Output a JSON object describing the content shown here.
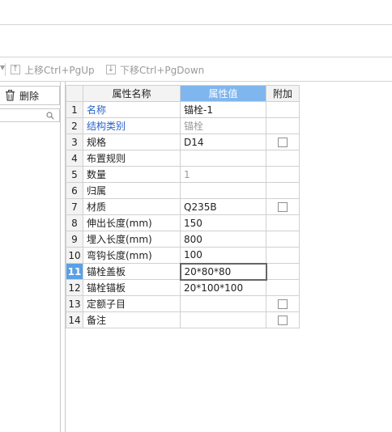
{
  "toolbar": {
    "move_up_label": "上移Ctrl+PgUp",
    "move_down_label": "下移Ctrl+PgDown"
  },
  "left_panel": {
    "delete_label": "删除",
    "search_placeholder": ""
  },
  "table": {
    "headers": {
      "name": "属性名称",
      "value": "属性值",
      "extra": "附加"
    },
    "rows": [
      {
        "num": "1",
        "name": "名称",
        "value": "锚栓-1",
        "checkbox": false
      },
      {
        "num": "2",
        "name": "结构类别",
        "value": "锚栓",
        "checkbox": false
      },
      {
        "num": "3",
        "name": "规格",
        "value": "D14",
        "checkbox": true
      },
      {
        "num": "4",
        "name": "布置规则",
        "value": "",
        "checkbox": false
      },
      {
        "num": "5",
        "name": "数量",
        "value": "1",
        "checkbox": false
      },
      {
        "num": "6",
        "name": "归属",
        "value": "",
        "checkbox": false
      },
      {
        "num": "7",
        "name": "材质",
        "value": "Q235B",
        "checkbox": true
      },
      {
        "num": "8",
        "name": "伸出长度(mm)",
        "value": "150",
        "checkbox": false
      },
      {
        "num": "9",
        "name": "埋入长度(mm)",
        "value": "800",
        "checkbox": false
      },
      {
        "num": "10",
        "name": "弯钩长度(mm)",
        "value": "100",
        "checkbox": false
      },
      {
        "num": "11",
        "name": "锚栓盖板",
        "value": "20*80*80",
        "checkbox": false
      },
      {
        "num": "12",
        "name": "锚栓锚板",
        "value": "20*100*100",
        "checkbox": false
      },
      {
        "num": "13",
        "name": "定额子目",
        "value": "",
        "checkbox": true
      },
      {
        "num": "14",
        "name": "备注",
        "value": "",
        "checkbox": true
      }
    ],
    "active_row": "11"
  },
  "colors": {
    "header_active": "#7fb6ee",
    "row_number_active": "#5aa0e6",
    "link_blue": "#2a63c8",
    "muted_grey": "#9a9a9a"
  }
}
